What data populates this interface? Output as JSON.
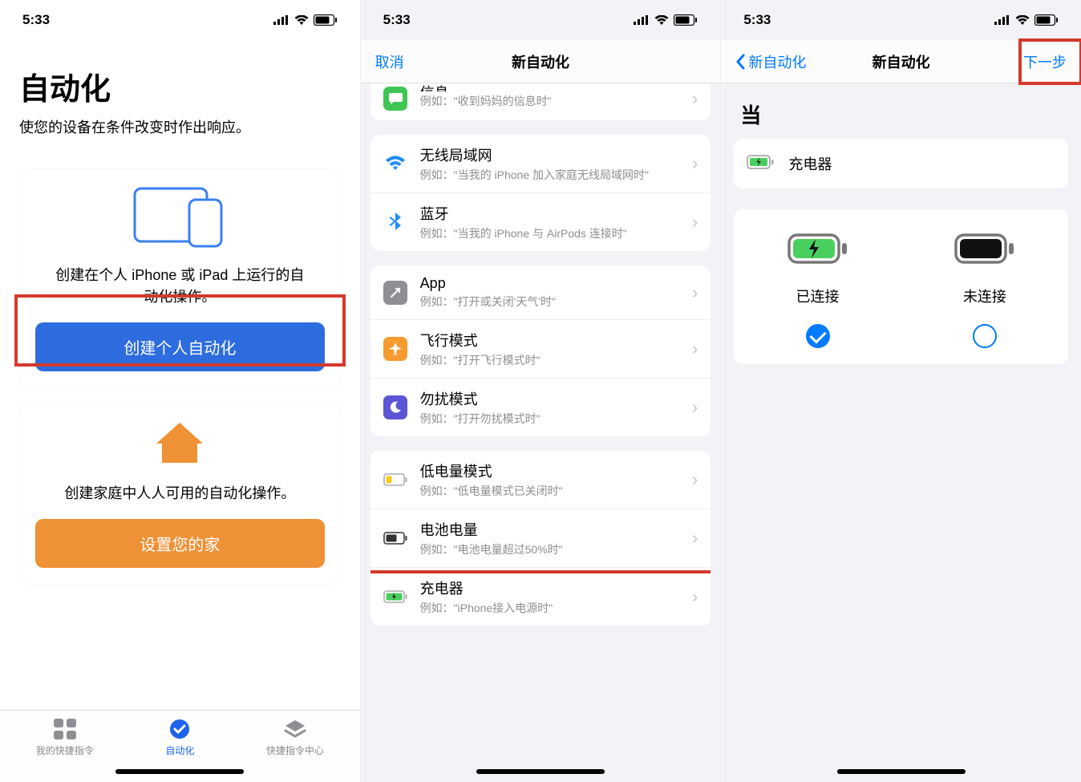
{
  "status": {
    "time": "5:33"
  },
  "s1": {
    "title": "自动化",
    "subtitle": "使您的设备在条件改变时作出响应。",
    "card1_desc": "创建在个人 iPhone 或 iPad 上运行的自动化操作。",
    "card1_btn": "创建个人自动化",
    "card2_desc": "创建家庭中人人可用的自动化操作。",
    "card2_btn": "设置您的家",
    "tab_shortcuts": "我的快捷指令",
    "tab_automation": "自动化",
    "tab_gallery": "快捷指令中心"
  },
  "s2": {
    "cancel": "取消",
    "title": "新自动化",
    "items": {
      "msg": {
        "title": "信息",
        "sub": "例如：\"收到妈妈的信息时\""
      },
      "wifi": {
        "title": "无线局域网",
        "sub": "例如：\"当我的 iPhone 加入家庭无线局域网时\""
      },
      "bt": {
        "title": "蓝牙",
        "sub": "例如：\"当我的 iPhone 与 AirPods 连接时\""
      },
      "app": {
        "title": "App",
        "sub": "例如：\"打开或关闭'天气'时\""
      },
      "air": {
        "title": "飞行模式",
        "sub": "例如：\"打开飞行模式时\""
      },
      "dnd": {
        "title": "勿扰模式",
        "sub": "例如：\"打开勿扰模式时\""
      },
      "lpm": {
        "title": "低电量模式",
        "sub": "例如：\"低电量模式已关闭时\""
      },
      "batt": {
        "title": "电池电量",
        "sub": "例如：\"电池电量超过50%时\""
      },
      "chg": {
        "title": "充电器",
        "sub": "例如：\"iPhone接入电源时\""
      }
    }
  },
  "s3": {
    "back": "新自动化",
    "title": "新自动化",
    "next": "下一步",
    "when": "当",
    "condition_label": "充电器",
    "opt_connected": "已连接",
    "opt_disconnected": "未连接"
  }
}
